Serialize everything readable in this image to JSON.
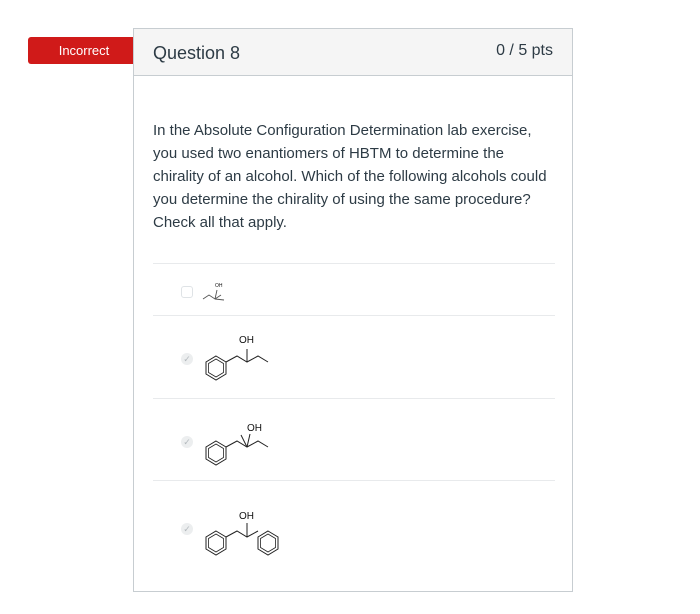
{
  "flag": {
    "label": "Incorrect",
    "color": "#d01a19"
  },
  "question": {
    "title": "Question 8",
    "points": "0 / 5 pts",
    "text": "In the Absolute Configuration Determination lab exercise, you used two enantiomers of HBTM to determine the chirality of an alcohol.  Which of the following alcohols could you determine the chirality of using the same procedure?  Check all that apply."
  },
  "answers": [
    {
      "structure": "2-butanol",
      "label": "OH",
      "checked": false
    },
    {
      "structure": "1-phenyl-2-butanol",
      "label": "OH",
      "checked": true
    },
    {
      "structure": "2-methyl-1-phenyl-2-butanol",
      "label": "OH",
      "checked": true
    },
    {
      "structure": "1,2-diphenylethanol",
      "label": "OH",
      "checked": true
    }
  ]
}
